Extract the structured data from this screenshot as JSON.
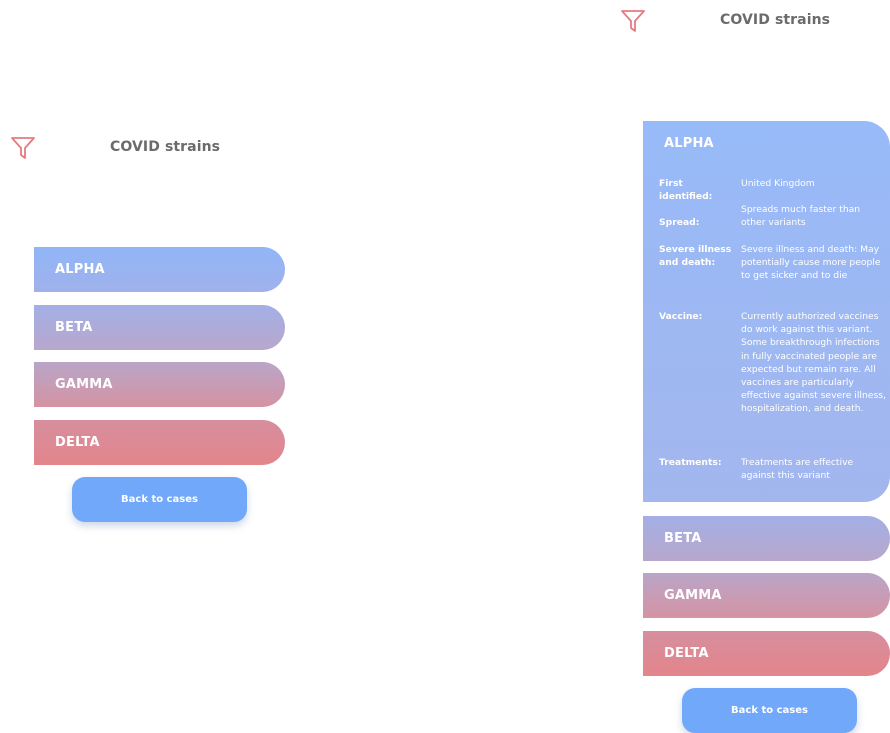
{
  "colors": {
    "icon": "#e57a80",
    "title": "#6b6b6b",
    "alpha": "#90b6f7",
    "beta": "#b0aad9",
    "gamma": "#cc98ae",
    "delta": "#e3858b",
    "button": "#72a8fa"
  },
  "icons": {
    "filter": "filter-funnel-icon"
  },
  "left_screen": {
    "header": {
      "title": "COVID strains"
    },
    "strains": [
      "ALPHA",
      "BETA",
      "GAMMA",
      "DELTA"
    ],
    "back_button": "Back to cases"
  },
  "right_screen": {
    "header": {
      "title": "COVID strains"
    },
    "expanded": {
      "name": "ALPHA",
      "details": [
        {
          "label": "First identified:",
          "value": "United Kingdom"
        },
        {
          "label": "Spread:",
          "value": "Spreads much faster than other variants"
        },
        {
          "label": "Severe illness and death:",
          "value": "Severe illness and death: May potentially cause more people to get sicker and to die"
        },
        {
          "label": "Vaccine:",
          "value": "Currently authorized vaccines do work against this variant. Some breakthrough infections in fully vaccinated people are expected but remain rare. All vaccines are particularly effective against severe illness, hospitalization, and death."
        },
        {
          "label": "Treatments:",
          "value": "Treatments are effective against this variant"
        }
      ]
    },
    "strains": [
      "BETA",
      "GAMMA",
      "DELTA"
    ],
    "back_button": "Back to cases"
  }
}
